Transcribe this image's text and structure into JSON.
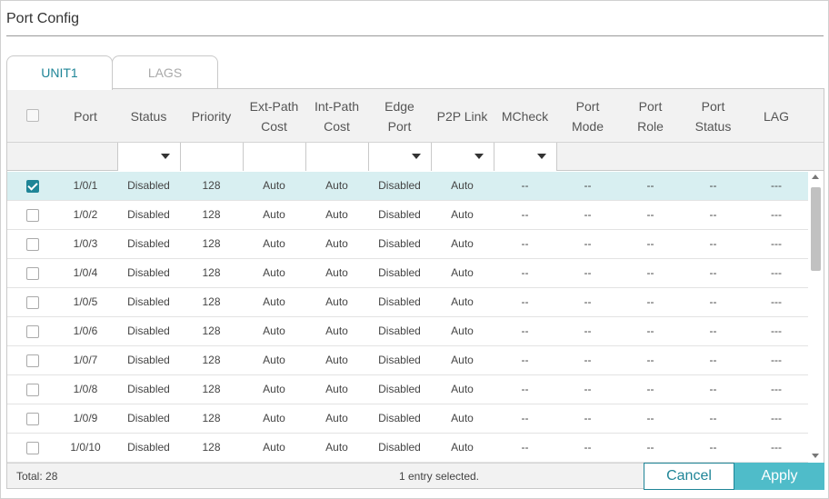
{
  "page": {
    "title": "Port Config"
  },
  "tabs": [
    {
      "label": "UNIT1",
      "active": true
    },
    {
      "label": "LAGS",
      "active": false
    }
  ],
  "table": {
    "headers": {
      "port": "Port",
      "status": "Status",
      "priority": "Priority",
      "ext_path_cost_1": "Ext-Path",
      "ext_path_cost_2": "Cost",
      "int_path_cost_1": "Int-Path",
      "int_path_cost_2": "Cost",
      "edge_port_1": "Edge",
      "edge_port_2": "Port",
      "p2p_link": "P2P Link",
      "mcheck": "MCheck",
      "port_mode_1": "Port",
      "port_mode_2": "Mode",
      "port_role_1": "Port",
      "port_role_2": "Role",
      "port_status_1": "Port",
      "port_status_2": "Status",
      "lag": "LAG"
    },
    "rows": [
      {
        "checked": true,
        "port": "1/0/1",
        "status": "Disabled",
        "priority": "128",
        "ext": "Auto",
        "int": "Auto",
        "edge": "Disabled",
        "p2p": "Auto",
        "mcheck": "--",
        "mode": "--",
        "role": "--",
        "pstatus": "--",
        "lag": "---"
      },
      {
        "checked": false,
        "port": "1/0/2",
        "status": "Disabled",
        "priority": "128",
        "ext": "Auto",
        "int": "Auto",
        "edge": "Disabled",
        "p2p": "Auto",
        "mcheck": "--",
        "mode": "--",
        "role": "--",
        "pstatus": "--",
        "lag": "---"
      },
      {
        "checked": false,
        "port": "1/0/3",
        "status": "Disabled",
        "priority": "128",
        "ext": "Auto",
        "int": "Auto",
        "edge": "Disabled",
        "p2p": "Auto",
        "mcheck": "--",
        "mode": "--",
        "role": "--",
        "pstatus": "--",
        "lag": "---"
      },
      {
        "checked": false,
        "port": "1/0/4",
        "status": "Disabled",
        "priority": "128",
        "ext": "Auto",
        "int": "Auto",
        "edge": "Disabled",
        "p2p": "Auto",
        "mcheck": "--",
        "mode": "--",
        "role": "--",
        "pstatus": "--",
        "lag": "---"
      },
      {
        "checked": false,
        "port": "1/0/5",
        "status": "Disabled",
        "priority": "128",
        "ext": "Auto",
        "int": "Auto",
        "edge": "Disabled",
        "p2p": "Auto",
        "mcheck": "--",
        "mode": "--",
        "role": "--",
        "pstatus": "--",
        "lag": "---"
      },
      {
        "checked": false,
        "port": "1/0/6",
        "status": "Disabled",
        "priority": "128",
        "ext": "Auto",
        "int": "Auto",
        "edge": "Disabled",
        "p2p": "Auto",
        "mcheck": "--",
        "mode": "--",
        "role": "--",
        "pstatus": "--",
        "lag": "---"
      },
      {
        "checked": false,
        "port": "1/0/7",
        "status": "Disabled",
        "priority": "128",
        "ext": "Auto",
        "int": "Auto",
        "edge": "Disabled",
        "p2p": "Auto",
        "mcheck": "--",
        "mode": "--",
        "role": "--",
        "pstatus": "--",
        "lag": "---"
      },
      {
        "checked": false,
        "port": "1/0/8",
        "status": "Disabled",
        "priority": "128",
        "ext": "Auto",
        "int": "Auto",
        "edge": "Disabled",
        "p2p": "Auto",
        "mcheck": "--",
        "mode": "--",
        "role": "--",
        "pstatus": "--",
        "lag": "---"
      },
      {
        "checked": false,
        "port": "1/0/9",
        "status": "Disabled",
        "priority": "128",
        "ext": "Auto",
        "int": "Auto",
        "edge": "Disabled",
        "p2p": "Auto",
        "mcheck": "--",
        "mode": "--",
        "role": "--",
        "pstatus": "--",
        "lag": "---"
      },
      {
        "checked": false,
        "port": "1/0/10",
        "status": "Disabled",
        "priority": "128",
        "ext": "Auto",
        "int": "Auto",
        "edge": "Disabled",
        "p2p": "Auto",
        "mcheck": "--",
        "mode": "--",
        "role": "--",
        "pstatus": "--",
        "lag": "---"
      }
    ]
  },
  "footer": {
    "total": "Total: 28",
    "selection": "1 entry selected.",
    "cancel_label": "Cancel",
    "apply_label": "Apply"
  },
  "colors": {
    "accent": "#1f8597",
    "apply": "#4fbcc9",
    "selected_row": "#d8eff1"
  },
  "icons": {
    "dropdown": "caret-down-icon",
    "scroll_up": "scroll-up-icon",
    "scroll_down": "scroll-down-icon"
  }
}
